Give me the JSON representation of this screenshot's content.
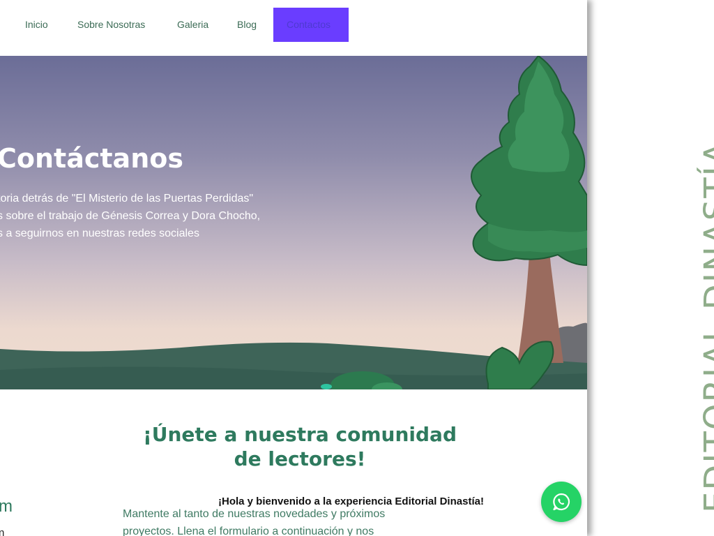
{
  "nav": {
    "items": [
      {
        "label": "Inicio"
      },
      {
        "label": "Sobre Nosotras"
      },
      {
        "label": "Galeria"
      },
      {
        "label": "Blog"
      },
      {
        "label": "Contactos"
      }
    ]
  },
  "hero": {
    "title": "Contáctanos",
    "lines": [
      "toria detrás de \"El Misterio de las Puertas Perdidas\"",
      "s sobre el trabajo de Génesis Correa y Dora Chocho,",
      "s a seguirnos en nuestras redes sociales"
    ]
  },
  "community": {
    "title_line1": "¡Únete a nuestra comunidad",
    "title_line2": "de lectores!",
    "left_fragment_1": "m",
    "left_fragment_2": "n",
    "body_line1": "Mantente al tanto de nuestras novedades y próximos",
    "body_line2": "proyectos. Llena el formulario a continuación y nos"
  },
  "chat": {
    "welcome": "¡Hola y bienvenido a la experiencia Editorial Dinastía!",
    "icon": "whatsapp-icon"
  },
  "brand": {
    "vertical_text": "EDITORIAL DINASTÍA",
    "color": "#8fad8a"
  },
  "colors": {
    "accent": "#6a3dff",
    "green": "#2e7a5e",
    "whatsapp": "#25d366"
  }
}
